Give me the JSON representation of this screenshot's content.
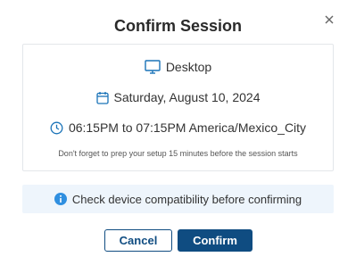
{
  "dialog": {
    "title": "Confirm Session",
    "close_icon": "close-icon"
  },
  "session": {
    "device": "Desktop",
    "date": "Saturday, August 10, 2024",
    "time": "06:15PM to 07:15PM America/Mexico_City",
    "note": "Don't forget to prep your setup 15 minutes before the session starts"
  },
  "info": {
    "text": "Check device compatibility before confirming"
  },
  "actions": {
    "cancel_label": "Cancel",
    "confirm_label": "Confirm"
  },
  "colors": {
    "primary": "#0f4c81",
    "icon_blue": "#1a73b8",
    "info_bg": "#eef5fc",
    "info_icon": "#2f8fe0"
  }
}
